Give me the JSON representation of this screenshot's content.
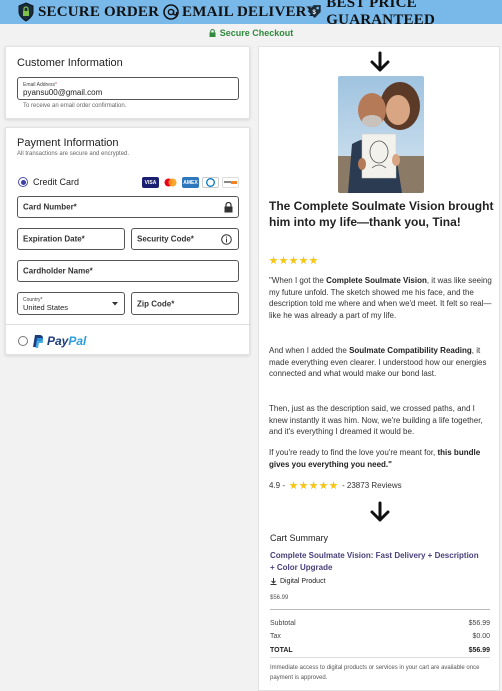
{
  "banner": {
    "secure_order": "SECURE ORDER",
    "email_delivery": "EMAIL DELIVERY",
    "best_price": "BEST PRICE GUARANTEED",
    "secure_checkout": "Secure Checkout",
    "bg_color": "#79b9ea"
  },
  "customer": {
    "title": "Customer Information",
    "email_label": "Email Address",
    "email_required": "*",
    "email_value": "pyansu00@gmail.com",
    "email_helper": "To receive an email order confirmation."
  },
  "payment": {
    "title": "Payment Information",
    "subtitle": "All transactions are secure and encrypted.",
    "credit_card_label": "Credit Card",
    "card_logos": [
      "visa",
      "mastercard",
      "amex",
      "diners",
      "discover"
    ],
    "card_number_placeholder": "Card Number*",
    "expiration_placeholder": "Expiration Date*",
    "security_code_placeholder": "Security Code*",
    "cardholder_placeholder": "Cardholder Name*",
    "country_label": "Country*",
    "country_value": "United States",
    "zip_placeholder": "Zip Code*",
    "paypal_pay": "Pay",
    "paypal_pal": "Pal"
  },
  "testimonial": {
    "headline": "The Complete Soulmate Vision brought him into my life—thank you, Tina!",
    "p1_a": "\"When I got the ",
    "p1_b": "Complete Soulmate Vision",
    "p1_c": ", it was like seeing my future unfold. The sketch showed me his face, and the description told me where and when we'd meet. It felt so real—like he was already a part of my life.",
    "p2_a": "And when I added the ",
    "p2_b": "Soulmate Compatibility Reading",
    "p2_c": ", it made everything even clearer. I understood how our energies connected and what would make our bond last.",
    "p3": "Then, just as the description said, we crossed paths, and I knew instantly it was him. Now, we're building a life together, and it's everything I dreamed it would be.",
    "p4_a": "If you're ready to find the love you're meant for, ",
    "p4_b": "this bundle gives you everything you need.\"",
    "rating_value": "4.9 -",
    "review_count": "- 23873 Reviews",
    "star_color": "#f5c518"
  },
  "cart": {
    "title": "Cart Summary",
    "product_name": "Complete Soulmate Vision: Fast Delivery + Description + Color Upgrade",
    "product_type": "Digital Product",
    "product_price": "$56.99",
    "subtotal_label": "Subtotal",
    "subtotal_value": "$56.99",
    "tax_label": "Tax",
    "tax_value": "$0.00",
    "total_label": "TOTAL",
    "total_value": "$56.99",
    "note": "Immediate access to digital products or services in your cart are available once payment is approved."
  }
}
